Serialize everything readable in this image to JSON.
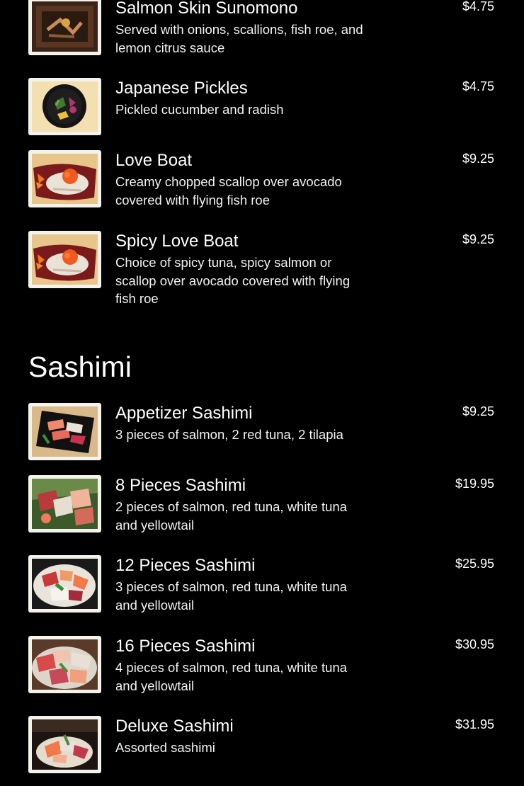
{
  "colors": {
    "background": "#000000",
    "text": "#ffffff",
    "thumb_frame": "#f4f2ec"
  },
  "appetizer_items": [
    {
      "name": "Salmon Skin Sunomono",
      "description": "Served with onions, scallions, fish roe, and lemon citrus sauce",
      "price": "$4.75",
      "image_icon": "salmon-skin-sunomono-photo"
    },
    {
      "name": "Japanese Pickles",
      "description": "Pickled cucumber and radish",
      "price": "$4.75",
      "image_icon": "japanese-pickles-photo"
    },
    {
      "name": "Love Boat",
      "description": "Creamy chopped scallop over avocado covered with flying fish roe",
      "price": "$9.25",
      "image_icon": "love-boat-photo"
    },
    {
      "name": "Spicy Love Boat",
      "description": "Choice of spicy tuna, spicy salmon or scallop over avocado covered with flying fish roe",
      "price": "$9.25",
      "image_icon": "spicy-love-boat-photo"
    }
  ],
  "sashimi_section": {
    "title": "Sashimi",
    "items": [
      {
        "name": "Appetizer Sashimi",
        "description": "3 pieces of salmon, 2 red tuna, 2 tilapia",
        "price": "$9.25",
        "image_icon": "appetizer-sashimi-photo"
      },
      {
        "name": "8 Pieces Sashimi",
        "description": "2 pieces of salmon, red tuna, white tuna and yellowtail",
        "price": "$19.95",
        "image_icon": "8-pieces-sashimi-photo"
      },
      {
        "name": "12 Pieces Sashimi",
        "description": "3 pieces of salmon, red tuna, white tuna and yellowtail",
        "price": "$25.95",
        "image_icon": "12-pieces-sashimi-photo"
      },
      {
        "name": "16 Pieces Sashimi",
        "description": "4 pieces of salmon, red tuna, white tuna and yellowtail",
        "price": "$30.95",
        "image_icon": "16-pieces-sashimi-photo"
      },
      {
        "name": "Deluxe Sashimi",
        "description": "Assorted sashimi",
        "price": "$31.95",
        "image_icon": "deluxe-sashimi-photo"
      }
    ]
  }
}
